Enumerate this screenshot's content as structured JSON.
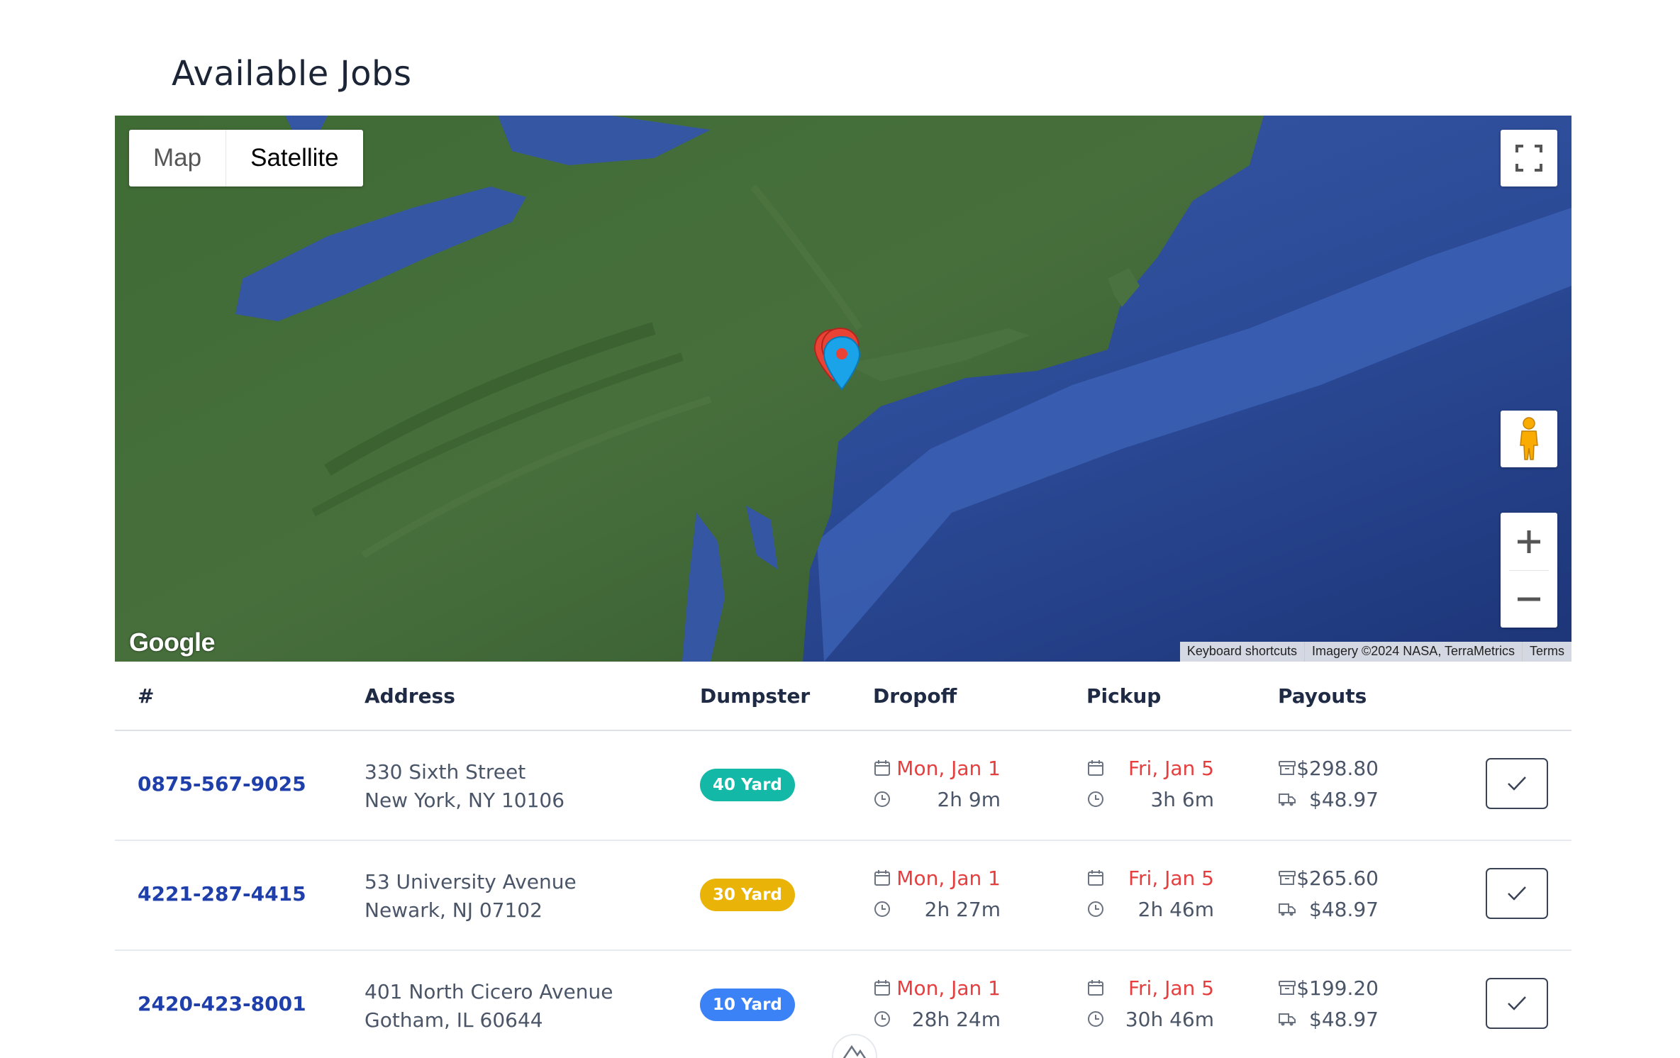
{
  "page": {
    "title": "Available Jobs"
  },
  "map": {
    "type_options": [
      "Map",
      "Satellite"
    ],
    "selected_type": "Satellite",
    "logo": "Google",
    "attribution": {
      "shortcuts": "Keyboard shortcuts",
      "imagery": "Imagery ©2024 NASA, TerraMetrics",
      "terms": "Terms"
    },
    "icons": {
      "fullscreen": "fullscreen-icon",
      "pegman": "pegman-icon",
      "zoom_in": "plus-icon",
      "zoom_out": "minus-icon",
      "pins": [
        "red-map-pin",
        "red-map-pin",
        "blue-map-pin"
      ]
    }
  },
  "table": {
    "headers": [
      "#",
      "Address",
      "Dumpster",
      "Dropoff",
      "Pickup",
      "Payouts"
    ],
    "rows": [
      {
        "id": "0875-567-9025",
        "address_line1": "330 Sixth Street",
        "address_line2": "New York, NY 10106",
        "dumpster": "40 Yard",
        "dropoff_date": "Mon, Jan 1",
        "dropoff_duration": "2h 9m",
        "pickup_date": "Fri, Jan 5",
        "pickup_duration": "3h 6m",
        "payout_job": "$298.80",
        "payout_delivery": "$48.97"
      },
      {
        "id": "4221-287-4415",
        "address_line1": "53 University Avenue",
        "address_line2": "Newark, NJ 07102",
        "dumpster": "30 Yard",
        "dropoff_date": "Mon, Jan 1",
        "dropoff_duration": "2h 27m",
        "pickup_date": "Fri, Jan 5",
        "pickup_duration": "2h 46m",
        "payout_job": "$265.60",
        "payout_delivery": "$48.97"
      },
      {
        "id": "2420-423-8001",
        "address_line1": "401 North Cicero Avenue",
        "address_line2": "Gotham, IL 60644",
        "dumpster": "10 Yard",
        "dropoff_date": "Mon, Jan 1",
        "dropoff_duration": "28h 24m",
        "pickup_date": "Fri, Jan 5",
        "pickup_duration": "30h 46m",
        "payout_job": "$199.20",
        "payout_delivery": "$48.97"
      }
    ]
  },
  "colors": {
    "accent_link": "#1f3faa",
    "date_red": "#e53e3e",
    "badge_40": "#14b8a6",
    "badge_30": "#eab308",
    "badge_10": "#3b82f6"
  }
}
